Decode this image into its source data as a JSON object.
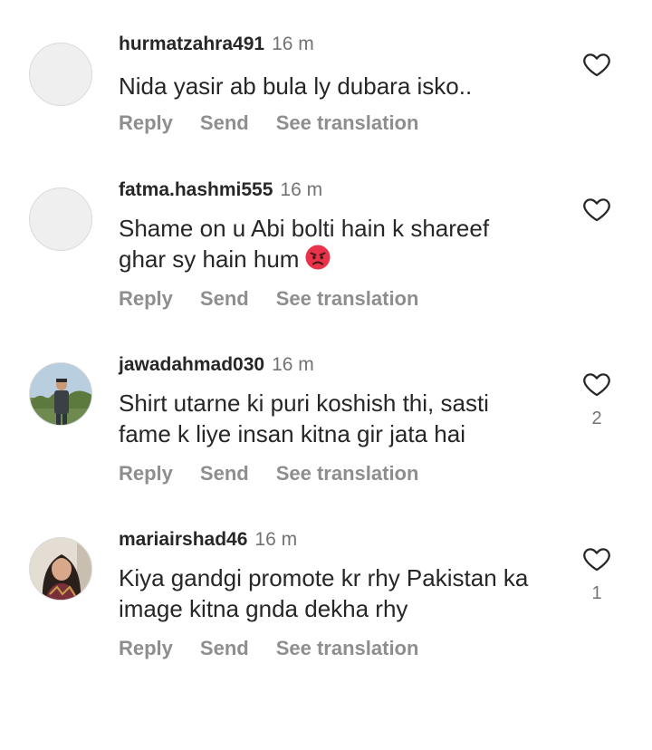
{
  "icons": {
    "like": "heart-outline-icon",
    "angry_emoji": "angry-face-emoji-icon"
  },
  "colors": {
    "username": "#262626",
    "meta": "#8e8e8e",
    "heart_stroke": "#262626",
    "avatar_placeholder": "#efefef",
    "emoji_red": "#e8334a"
  },
  "comments": [
    {
      "username": "hurmatzahra491",
      "time": "16 m",
      "text": "Nida yasir ab bula ly dubara isko..",
      "actions": {
        "reply": "Reply",
        "send": "Send",
        "translate": "See translation"
      },
      "likes": ""
    },
    {
      "username": "fatma.hashmi555",
      "time": "16 m",
      "text_line1": "Shame on u Abi bolti hain k shareef",
      "text_line2": "ghar sy hain hum",
      "actions": {
        "reply": "Reply",
        "send": "Send",
        "translate": "See translation"
      },
      "likes": ""
    },
    {
      "username": "jawadahmad030",
      "time": "16 m",
      "text_line1": "Shirt utarne ki puri koshish thi, sasti",
      "text_line2": "fame k liye insan kitna gir jata hai",
      "actions": {
        "reply": "Reply",
        "send": "Send",
        "translate": "See translation"
      },
      "likes": "2"
    },
    {
      "username": "mariairshad46",
      "time": "16 m",
      "text_line1": "Kiya gandgi promote kr rhy Pakistan ka",
      "text_line2": "image kitna gnda dekha rhy",
      "actions": {
        "reply": "Reply",
        "send": "Send",
        "translate": "See translation"
      },
      "likes": "1"
    }
  ]
}
